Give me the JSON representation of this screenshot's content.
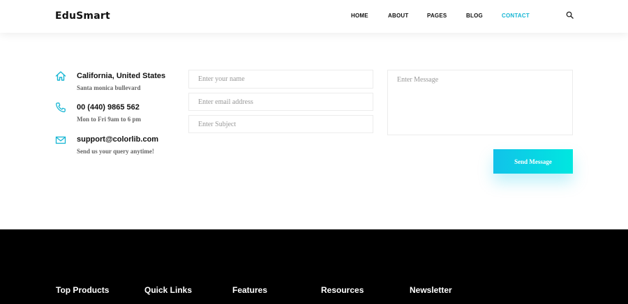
{
  "header": {
    "logo": "EduSmart",
    "nav": [
      {
        "label": "HOME",
        "active": false
      },
      {
        "label": "ABOUT",
        "active": false
      },
      {
        "label": "PAGES",
        "active": false
      },
      {
        "label": "BLOG",
        "active": false
      },
      {
        "label": "CONTACT",
        "active": true
      }
    ],
    "search_icon": "search-icon"
  },
  "contact_info": [
    {
      "icon": "home-icon",
      "title": "California, United States",
      "subtitle": "Santa monica bullevard"
    },
    {
      "icon": "phone-icon",
      "title": "00 (440) 9865 562",
      "subtitle": "Mon to Fri 9am to 6 pm"
    },
    {
      "icon": "mail-icon",
      "title": "support@colorlib.com",
      "subtitle": "Send us your query anytime!"
    }
  ],
  "form": {
    "name_placeholder": "Enter your name",
    "email_placeholder": "Enter email address",
    "subject_placeholder": "Enter Subject",
    "message_placeholder": "Enter Message",
    "send_label": "Send Message"
  },
  "footer": {
    "headings": [
      "Top Products",
      "Quick Links",
      "Features",
      "Resources",
      "Newsletter"
    ]
  },
  "colors": {
    "accent": "#17b6d4",
    "button_gradient_start": "#12c2e9",
    "button_gradient_end": "#00e7e0",
    "footer_bg": "#000000"
  }
}
